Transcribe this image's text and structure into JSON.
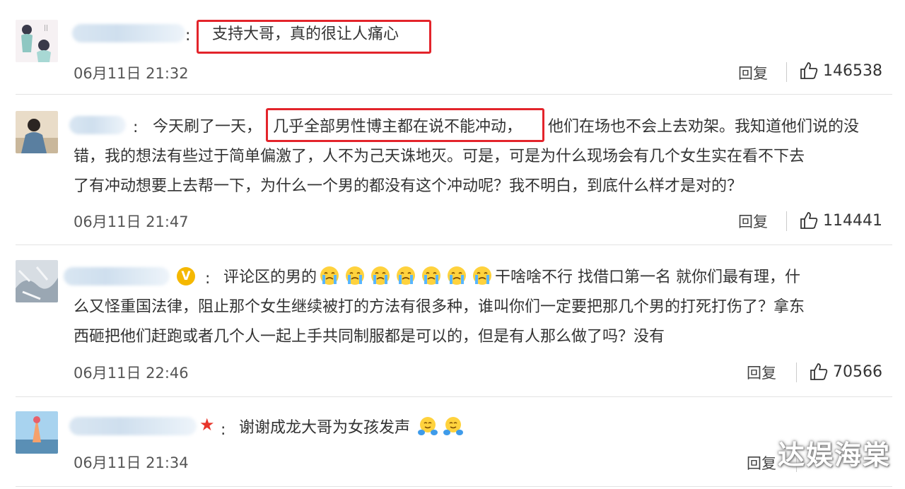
{
  "comments": [
    {
      "text_lines": [
        "支持大哥，真的很让人痛心"
      ],
      "time": "06月11日 21:32",
      "reply": "回复",
      "likes": "146538"
    },
    {
      "text_lines": [
        "今天刷了一天，",
        "几乎全部男性博主都在说不能冲动，",
        "他们在场也不会上去劝架。我知道他们说的没",
        "错，我的想法有些过于简单偏激了，人不为己天诛地灭。可是，可是为什么现场会有几个女生实在看不下去",
        "了有冲动想要上去帮一下，为什么一个男的都没有这个冲动呢？我不明白，到底什么样才是对的？"
      ],
      "time": "06月11日 21:47",
      "reply": "回复",
      "likes": "114441"
    },
    {
      "badge": "V",
      "text_lines": [
        "评论区的男的",
        "干啥啥不行 找借口第一名 就你们最有理，什",
        "么又怪重国法律，阻止那个女生继续被打的方法有很多种，谁叫你们一定要把那几个男的打死打伤了？拿东",
        "西砸把他们赶跑或者几个人一起上手共同制服都是可以的，但是有人那么做了吗？没有"
      ],
      "time": "06月11日 22:46",
      "reply": "回复",
      "likes": "70566"
    },
    {
      "text_lines": [
        "谢谢成龙大哥为女孩发声"
      ],
      "time": "06月11日 21:34",
      "reply": "回复"
    }
  ],
  "watermark": "达娱海棠",
  "colors": {
    "highlight": "#e3242b",
    "badge": "#f5b800",
    "star": "#e8352a"
  }
}
